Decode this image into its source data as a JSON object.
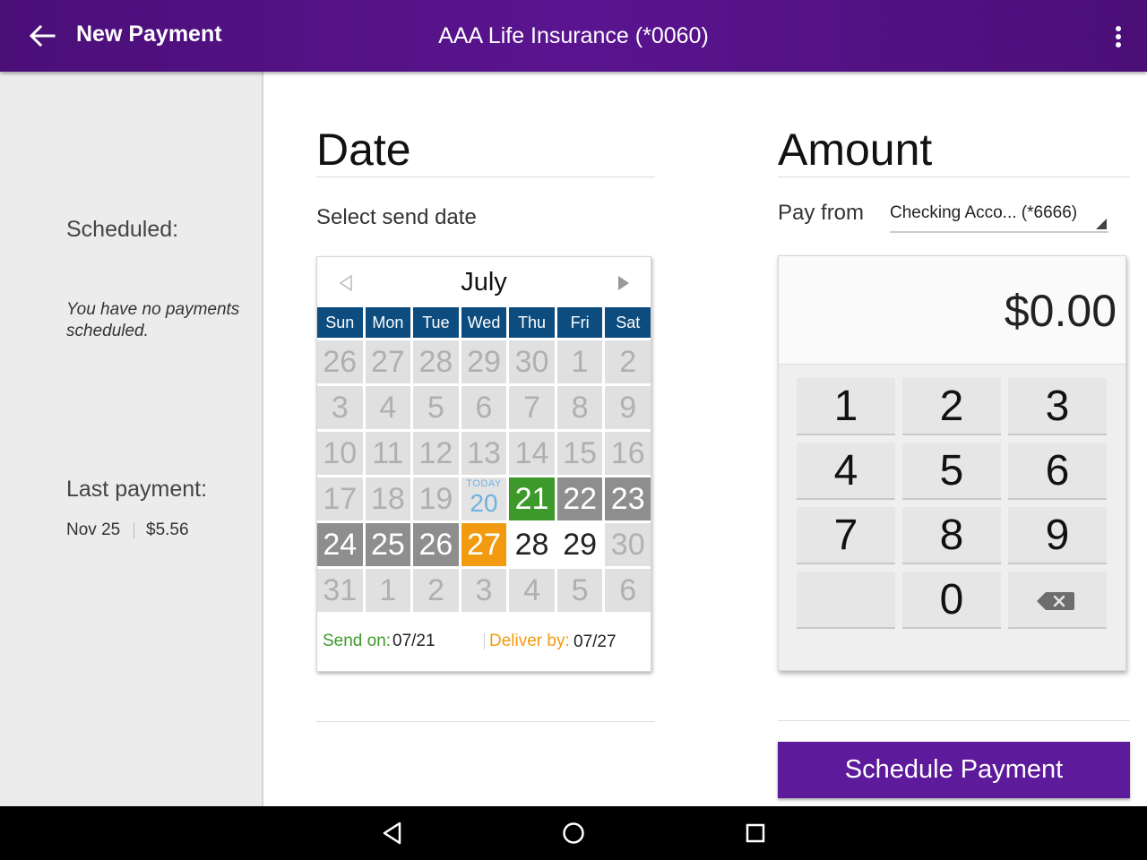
{
  "appbar": {
    "title": "New Payment",
    "payee": "AAA Life Insurance (*0060)",
    "icons": {
      "back": "arrow-left-icon",
      "overflow": "more-vert-icon"
    }
  },
  "left_panel": {
    "scheduled_label": "Scheduled:",
    "scheduled_text": "You have no payments scheduled.",
    "last_payment_label": "Last payment:",
    "last_payment_date": "Nov 25",
    "last_payment_amount": "$5.56"
  },
  "date_section": {
    "title": "Date",
    "subtitle": "Select send date",
    "calendar": {
      "month": "July",
      "weekdays": [
        "Sun",
        "Mon",
        "Tue",
        "Wed",
        "Thu",
        "Fri",
        "Sat"
      ],
      "today_label": "TODAY",
      "weeks": [
        [
          "26",
          "27",
          "28",
          "29",
          "30",
          "1",
          "2"
        ],
        [
          "3",
          "4",
          "5",
          "6",
          "7",
          "8",
          "9"
        ],
        [
          "10",
          "11",
          "12",
          "13",
          "14",
          "15",
          "16"
        ],
        [
          "17",
          "18",
          "19",
          "20",
          "21",
          "22",
          "23"
        ],
        [
          "24",
          "25",
          "26",
          "27",
          "28",
          "29",
          "30"
        ],
        [
          "31",
          "1",
          "2",
          "3",
          "4",
          "5",
          "6"
        ]
      ],
      "send_on_label": "Send on:",
      "send_on_value": "07/21",
      "deliver_by_label": "Deliver by:",
      "deliver_by_value": "07/27"
    }
  },
  "amount_section": {
    "title": "Amount",
    "pay_from_label": "Pay from",
    "account_selected": "Checking Acco...  (*6666)",
    "amount_value": "$0.00",
    "keys": [
      "1",
      "2",
      "3",
      "4",
      "5",
      "6",
      "7",
      "8",
      "9",
      "",
      "0",
      "backspace"
    ]
  },
  "schedule_button": "Schedule Payment",
  "colors": {
    "appbar": "#5a1490",
    "weekday_header": "#0d4c7e",
    "send_day": "#3d9a2a",
    "deliver_day": "#f29b11",
    "range_day": "#8e8e8e",
    "today": "#6fb3e0",
    "primary_button": "#5d1a9a"
  }
}
